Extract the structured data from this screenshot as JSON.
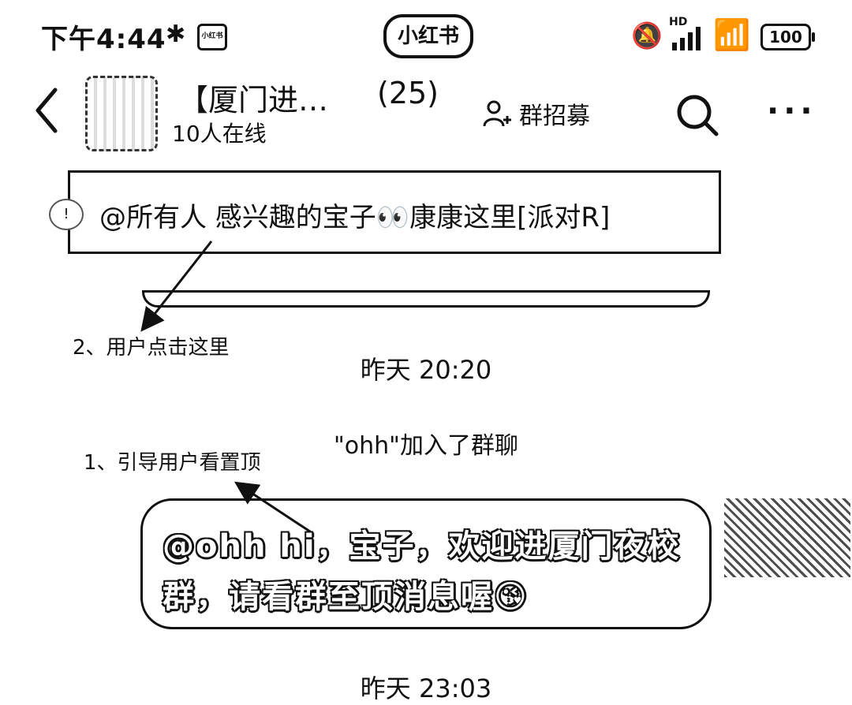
{
  "status_bar": {
    "time": "下午4:44",
    "brand": "小红书",
    "hd_label": "HD",
    "battery": "100",
    "icons": [
      "bluetooth-icon",
      "app-icon",
      "mute-icon",
      "signal-icon",
      "wifi-icon",
      "battery-icon"
    ]
  },
  "header": {
    "title": "【厦门进…",
    "member_count": "(25)",
    "online": "10人在线",
    "recruit_label": "群招募",
    "icons": [
      "back-icon",
      "group-avatar",
      "add-user-icon",
      "search-icon",
      "more-icon"
    ]
  },
  "pinned": {
    "text": "@所有人 感兴趣的宝子👀康康这里[派对R]"
  },
  "annotations": {
    "step2": "2、用户点击这里",
    "step1": "1、引导用户看置顶"
  },
  "chat": {
    "timestamp1": "昨天 20:20",
    "join_notice": "\"ohh\"加入了群聊",
    "message_line1": "@ohh hi，宝子，欢迎进厦门夜校",
    "message_line2": "群，请看群至顶消息喔😘",
    "timestamp2": "昨天 23:03"
  }
}
